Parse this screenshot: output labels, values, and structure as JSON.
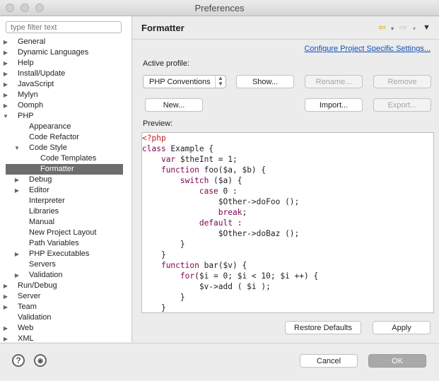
{
  "window": {
    "title": "Preferences"
  },
  "filter": {
    "placeholder": "type filter text"
  },
  "tree": [
    {
      "label": "General",
      "depth": 0,
      "arrow": "right"
    },
    {
      "label": "Dynamic Languages",
      "depth": 0,
      "arrow": "right"
    },
    {
      "label": "Help",
      "depth": 0,
      "arrow": "right"
    },
    {
      "label": "Install/Update",
      "depth": 0,
      "arrow": "right"
    },
    {
      "label": "JavaScript",
      "depth": 0,
      "arrow": "right"
    },
    {
      "label": "Mylyn",
      "depth": 0,
      "arrow": "right"
    },
    {
      "label": "Oomph",
      "depth": 0,
      "arrow": "right"
    },
    {
      "label": "PHP",
      "depth": 0,
      "arrow": "down"
    },
    {
      "label": "Appearance",
      "depth": 1,
      "arrow": ""
    },
    {
      "label": "Code Refactor",
      "depth": 1,
      "arrow": ""
    },
    {
      "label": "Code Style",
      "depth": 1,
      "arrow": "down"
    },
    {
      "label": "Code Templates",
      "depth": 2,
      "arrow": ""
    },
    {
      "label": "Formatter",
      "depth": 2,
      "arrow": "",
      "selected": true
    },
    {
      "label": "Debug",
      "depth": 1,
      "arrow": "right"
    },
    {
      "label": "Editor",
      "depth": 1,
      "arrow": "right"
    },
    {
      "label": "Interpreter",
      "depth": 1,
      "arrow": ""
    },
    {
      "label": "Libraries",
      "depth": 1,
      "arrow": ""
    },
    {
      "label": "Manual",
      "depth": 1,
      "arrow": ""
    },
    {
      "label": "New Project Layout",
      "depth": 1,
      "arrow": ""
    },
    {
      "label": "Path Variables",
      "depth": 1,
      "arrow": ""
    },
    {
      "label": "PHP Executables",
      "depth": 1,
      "arrow": "right"
    },
    {
      "label": "Servers",
      "depth": 1,
      "arrow": ""
    },
    {
      "label": "Validation",
      "depth": 1,
      "arrow": "right"
    },
    {
      "label": "Run/Debug",
      "depth": 0,
      "arrow": "right"
    },
    {
      "label": "Server",
      "depth": 0,
      "arrow": "right"
    },
    {
      "label": "Team",
      "depth": 0,
      "arrow": "right"
    },
    {
      "label": "Validation",
      "depth": 0,
      "arrow": ""
    },
    {
      "label": "Web",
      "depth": 0,
      "arrow": "right"
    },
    {
      "label": "XML",
      "depth": 0,
      "arrow": "right"
    }
  ],
  "page": {
    "title": "Formatter",
    "configure_link": "Configure Project Specific Settings...",
    "active_profile_label": "Active profile:",
    "profile_value": "PHP Conventions",
    "buttons": {
      "show": "Show...",
      "rename": "Rename...",
      "remove": "Remove",
      "new": "New...",
      "import": "Import...",
      "export": "Export..."
    },
    "preview_label": "Preview:",
    "code": [
      [
        {
          "t": "<?php",
          "c": "#d01818"
        }
      ],
      [
        {
          "t": "class",
          "c": "#7f0055"
        },
        {
          "t": " Example {",
          "c": "#222"
        }
      ],
      [
        {
          "t": "    ",
          "c": "#222"
        },
        {
          "t": "var",
          "c": "#7f0055"
        },
        {
          "t": " $theInt = 1;",
          "c": "#222"
        }
      ],
      [
        {
          "t": "    ",
          "c": "#222"
        },
        {
          "t": "function",
          "c": "#7f0055"
        },
        {
          "t": " foo($a, $b) {",
          "c": "#222"
        }
      ],
      [
        {
          "t": "        ",
          "c": "#222"
        },
        {
          "t": "switch",
          "c": "#7f0055"
        },
        {
          "t": " ($a) {",
          "c": "#222"
        }
      ],
      [
        {
          "t": "            ",
          "c": "#222"
        },
        {
          "t": "case",
          "c": "#7f0055"
        },
        {
          "t": " 0 :",
          "c": "#222"
        }
      ],
      [
        {
          "t": "                $Other->doFoo ();",
          "c": "#222"
        }
      ],
      [
        {
          "t": "                ",
          "c": "#222"
        },
        {
          "t": "break",
          "c": "#7f0055"
        },
        {
          "t": ";",
          "c": "#222"
        }
      ],
      [
        {
          "t": "            ",
          "c": "#222"
        },
        {
          "t": "default",
          "c": "#7f0055"
        },
        {
          "t": " :",
          "c": "#222"
        }
      ],
      [
        {
          "t": "                $Other->doBaz ();",
          "c": "#222"
        }
      ],
      [
        {
          "t": "        }",
          "c": "#222"
        }
      ],
      [
        {
          "t": "    }",
          "c": "#222"
        }
      ],
      [
        {
          "t": "    ",
          "c": "#222"
        },
        {
          "t": "function",
          "c": "#7f0055"
        },
        {
          "t": " bar($v) {",
          "c": "#222"
        }
      ],
      [
        {
          "t": "        ",
          "c": "#222"
        },
        {
          "t": "for",
          "c": "#7f0055"
        },
        {
          "t": "($i = 0; $i < 10; $i ++) {",
          "c": "#222"
        }
      ],
      [
        {
          "t": "            $v->add ( $i );",
          "c": "#222"
        }
      ],
      [
        {
          "t": "        }",
          "c": "#222"
        }
      ],
      [
        {
          "t": "    }",
          "c": "#222"
        }
      ]
    ],
    "restore_defaults": "Restore Defaults",
    "apply": "Apply"
  },
  "footer": {
    "cancel": "Cancel",
    "ok": "OK"
  },
  "icons": {
    "back": "back-arrow-icon",
    "forward": "forward-arrow-icon",
    "menu": "view-menu-icon",
    "help": "help-icon",
    "import_export": "import-export-icon"
  }
}
